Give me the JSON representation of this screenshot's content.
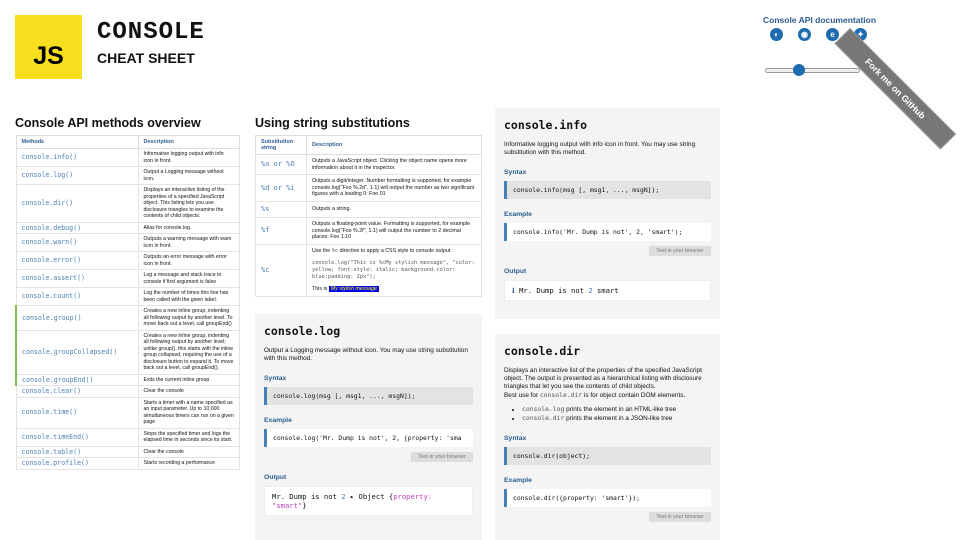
{
  "header": {
    "logo": "JS",
    "title": "CONSOLE",
    "subtitle": "CHEAT SHEET",
    "docs_link": "Console API documentation",
    "browsers": [
      "chrome-icon",
      "firefox-icon",
      "edge-icon",
      "safari-icon"
    ],
    "ribbon": "Fork me on GitHub"
  },
  "methods": {
    "heading": "Console API methods overview",
    "col_method": "Methods",
    "col_desc": "Description",
    "rows": [
      {
        "m": "console.info()",
        "d": "Informative logging output with info icon in front."
      },
      {
        "m": "console.log()",
        "d": "Output a Logging message without icon."
      },
      {
        "m": "console.dir()",
        "d": "Displays an interactive listing of the properties of a specified JavaScript object. This listing lets you use disclosure triangles to examine the contents of child objects."
      },
      {
        "m": "console.debug()",
        "d": "Alias for console.log."
      },
      {
        "m": "console.warn()",
        "d": "Outputs a warning message with warn icon in front."
      },
      {
        "m": "console.error()",
        "d": "Outputs an error message with error icon in front."
      },
      {
        "m": "console.assert()",
        "d": "Log a message and stack trace to console if first argument is false"
      },
      {
        "m": "console.count()",
        "d": "Log the number of times this line has been called with the given label."
      },
      {
        "m": "console.group()",
        "d": "Creates a new inline group, indenting all following output by another level. To move back out a level, call groupEnd()"
      },
      {
        "m": "console.groupCollapsed()",
        "d": "Creates a new inline group, indenting all following output by another level; unlike group(), this starts with the inline group collapsed, requiring the use of a disclosure button to expand it. To move back out a level, call groupEnd()."
      },
      {
        "m": "console.groupEnd()",
        "d": "Exits the current inline group"
      },
      {
        "m": "console.clear()",
        "d": "Clear the console"
      },
      {
        "m": "console.time()",
        "d": "Starts a timer with a name specified as an input parameter. Up to 10,000 simultaneous timers can run on a given page"
      },
      {
        "m": "console.timeEnd()",
        "d": "Stops the specified timer and logs the elapsed time in seconds since its start."
      },
      {
        "m": "console.table()",
        "d": "Clear the console"
      },
      {
        "m": "console.profile()",
        "d": "Starts recording a performance"
      }
    ]
  },
  "subs": {
    "heading": "Using string substitutions",
    "col_sub": "Substitution string",
    "col_desc": "Description",
    "rows": [
      {
        "s": "%o or %O",
        "d": "Outputs a JavaScript object. Clicking the object name opens more information about it in the inspector."
      },
      {
        "s": "%d or %i",
        "d": "Outputs a digit/integer. Number formatting is supported, for example console.log(\"Foo %.2d\", 1.1) will output the number as two significant figures with a leading 0: Foo 01"
      },
      {
        "s": "%s",
        "d": "Outputs a string."
      },
      {
        "s": "%f",
        "d": "Outputs a floating-point value. Formatting is supported, for example console.log(\"Foo %.2f\", 1.1) will output the number to 2 decimal places: Foo 1.10"
      }
    ],
    "css_sub": "%c",
    "css_desc_a": "Use the ",
    "css_desc_code": "%c",
    "css_desc_b": " directive to apply a CSS style to console output.",
    "css_code": "console.log(\"This is %cMy stylish message\", \"color: yellow; font-style: italic; background-color: blue;padding: 2px\");",
    "css_out_a": "This is ",
    "css_out_styled": "My stylish message"
  },
  "log_card": {
    "title": "console.log",
    "desc": "Output a Logging message without icon. You may use string substitution with this method.",
    "syntax_h": "Syntax",
    "syntax": "console.log(msg [, msg1, ..., msgN]);",
    "example_h": "Example",
    "example": "console.log('Mr. Dump is not', 2, {property: 'sma",
    "try": "Test in your browser",
    "output_h": "Output",
    "out_a": "Mr. Dump is not ",
    "out_num": "2",
    "out_b": " ▸ Object {",
    "out_prop": "property:",
    "out_str": "\"smart\"",
    "out_end": "}"
  },
  "info_card": {
    "title": "console.info",
    "desc": "Informative logging output with info icon in front. You may use string substitution with this method.",
    "syntax_h": "Syntax",
    "syntax": "console.info(msg [, msg1, ..., msgN]);",
    "example_h": "Example",
    "example": "console.info('Mr. Dump is not', 2, 'smart');",
    "try": "Test in your browser",
    "output_h": "Output",
    "out_a": "Mr. Dump is not ",
    "out_num": "2",
    "out_b": " smart"
  },
  "dir_card": {
    "title": "console.dir",
    "desc": "Displays an interactive list of the properties of the specified JavaScript object. The output is presented as a hierarchical listing with disclosure triangles that let you see the contents of child objects.",
    "best_a": "Best use for ",
    "best_code": "console.dir",
    "best_b": " is for object contain DOM elements.",
    "li1_code": "console.log",
    "li1_text": " prints the element in an HTML-like tree",
    "li2_code": "console.dir",
    "li2_text": " prints the element in a JSON-like tree",
    "syntax_h": "Syntax",
    "syntax": "console.dir(object);",
    "example_h": "Example",
    "example": "console.dir({property: 'smart'});",
    "try": "Test in your browser"
  },
  "colors": {
    "accent": "#4a7fb5",
    "logo": "#f7df1e",
    "heading": "#2c5d8f"
  }
}
